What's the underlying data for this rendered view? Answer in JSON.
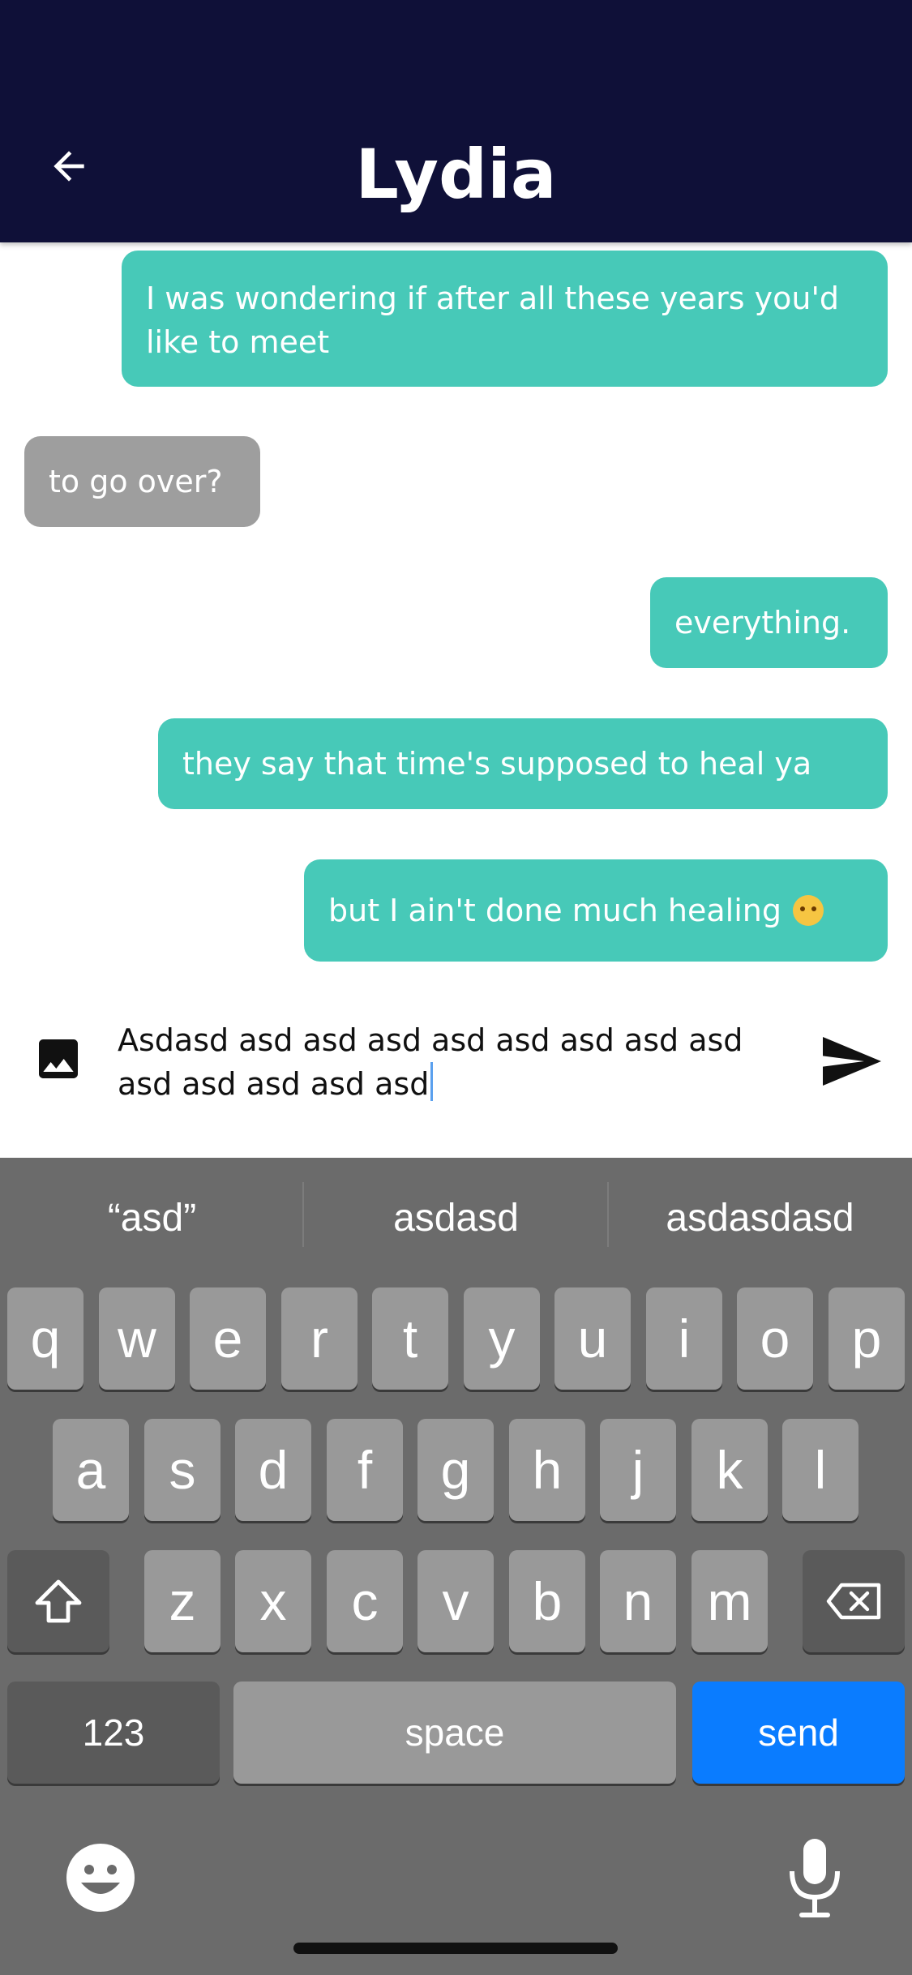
{
  "header": {
    "title": "Lydia",
    "back_icon": "arrow-left-icon",
    "background": "#0f1038"
  },
  "messages": [
    {
      "from": "me",
      "text": "I was wondering if after all these years you'd like to meet"
    },
    {
      "from": "them",
      "text": "to go over?"
    },
    {
      "from": "me",
      "text": "everything."
    },
    {
      "from": "me",
      "text": "they say that time's supposed to heal ya"
    },
    {
      "from": "me",
      "text": "but I ain't done much healing",
      "emoji": "angry-face-icon"
    }
  ],
  "colors": {
    "mine_bubble": "#47c9b8",
    "theirs_bubble": "#9e9e9e",
    "keyboard_bg": "#6b6b6b",
    "send_key": "#0a7cff"
  },
  "composer": {
    "value": "Asdasd asd asd asd asd asd asd asd asd asd asd asd asd asd",
    "image_icon": "image-icon",
    "send_icon": "send-icon"
  },
  "keyboard": {
    "suggestions": [
      "“asd”",
      "asdasd",
      "asdasdasd"
    ],
    "row1": [
      "q",
      "w",
      "e",
      "r",
      "t",
      "y",
      "u",
      "i",
      "o",
      "p"
    ],
    "row2": [
      "a",
      "s",
      "d",
      "f",
      "g",
      "h",
      "j",
      "k",
      "l"
    ],
    "row3": [
      "z",
      "x",
      "c",
      "v",
      "b",
      "n",
      "m"
    ],
    "numbers_label": "123",
    "space_label": "space",
    "send_label": "send",
    "shift_icon": "shift-icon",
    "backspace_icon": "backspace-icon",
    "emoji_icon": "emoji-icon",
    "mic_icon": "microphone-icon"
  }
}
